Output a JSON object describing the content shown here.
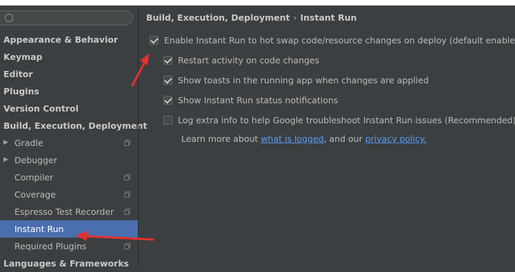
{
  "sidebar": {
    "items": [
      {
        "label": "Appearance & Behavior",
        "level": "top"
      },
      {
        "label": "Keymap",
        "level": "top"
      },
      {
        "label": "Editor",
        "level": "top"
      },
      {
        "label": "Plugins",
        "level": "top"
      },
      {
        "label": "Version Control",
        "level": "top"
      },
      {
        "label": "Build, Execution, Deployment",
        "level": "top"
      },
      {
        "label": "Gradle",
        "level": "child"
      },
      {
        "label": "Debugger",
        "level": "child"
      },
      {
        "label": "Compiler",
        "level": "child"
      },
      {
        "label": "Coverage",
        "level": "child"
      },
      {
        "label": "Espresso Test Recorder",
        "level": "child"
      },
      {
        "label": "Instant Run",
        "level": "child",
        "selected": true
      },
      {
        "label": "Required Plugins",
        "level": "child"
      },
      {
        "label": "Languages & Frameworks",
        "level": "top"
      }
    ]
  },
  "breadcrumb": {
    "parent": "Build, Execution, Deployment",
    "separator": "›",
    "current": "Instant Run"
  },
  "options": [
    {
      "label": "Enable Instant Run to hot swap code/resource changes on deploy (default enabled)",
      "checked": true
    },
    {
      "label": "Restart activity on code changes",
      "checked": true
    },
    {
      "label": "Show toasts in the running app when changes are applied",
      "checked": true
    },
    {
      "label": "Show Instant Run status notifications",
      "checked": true
    },
    {
      "label": "Log extra info to help Google troubleshoot Instant Run issues (Recommended)",
      "checked": false
    }
  ],
  "info": {
    "prefix": "Learn more about",
    "link1": "what is logged",
    "middle": ", and our",
    "link2": "privacy policy."
  },
  "colors": {
    "selected": "#4b6eaf",
    "link": "#589df6",
    "annotation_arrow": "#e8302c"
  }
}
